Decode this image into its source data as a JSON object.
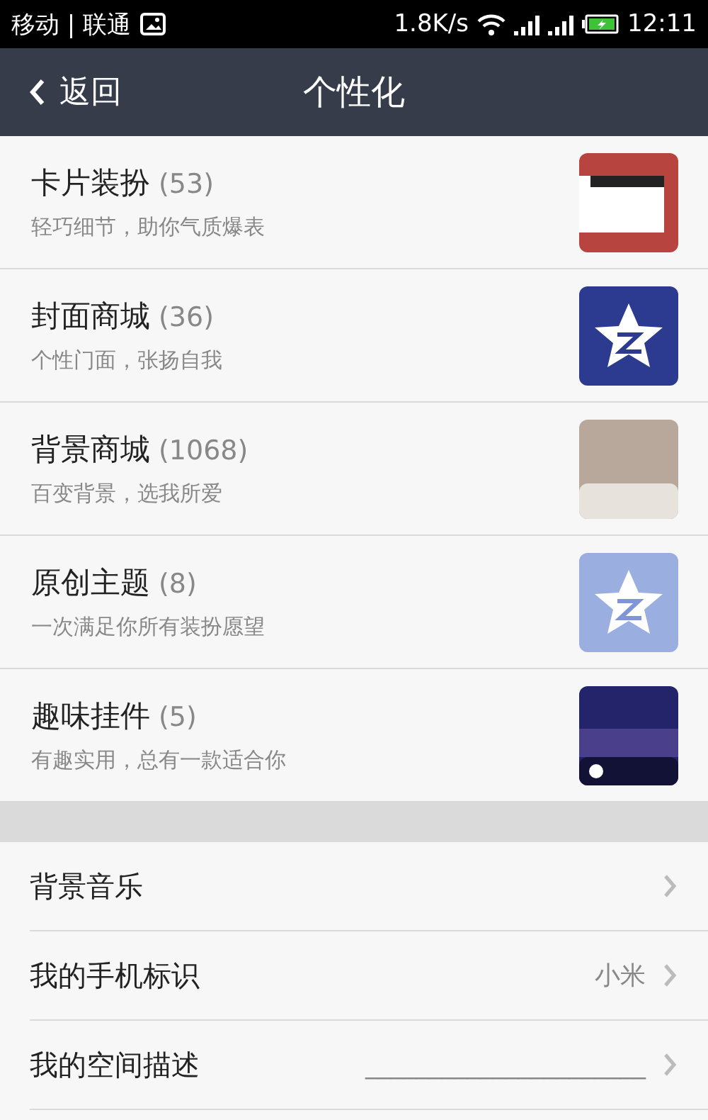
{
  "status_bar": {
    "carrier": "移动 | 联通",
    "speed": "1.8K/s",
    "time": "12:11"
  },
  "header": {
    "back": "返回",
    "title": "个性化"
  },
  "items": [
    {
      "title": "卡片装扮",
      "count": "(53)",
      "subtitle": "轻巧细节，助你气质爆表",
      "kind": "framed"
    },
    {
      "title": "封面商城",
      "count": "(36)",
      "subtitle": "个性门面，张扬自我",
      "kind": "star-dark"
    },
    {
      "title": "背景商城",
      "count": "(1068)",
      "subtitle": "百变背景，选我所爱",
      "kind": "photo"
    },
    {
      "title": "原创主题",
      "count": "(8)",
      "subtitle": "一次满足你所有装扮愿望",
      "kind": "star-light"
    },
    {
      "title": "趣味挂件",
      "count": "(5)",
      "subtitle": "有趣实用，总有一款适合你",
      "kind": "night-sky"
    }
  ],
  "settings": [
    {
      "label": "背景音乐"
    },
    {
      "label": "我的手机标识",
      "value": "小米"
    },
    {
      "label": "我的空间描述",
      "value": "______________________"
    }
  ]
}
